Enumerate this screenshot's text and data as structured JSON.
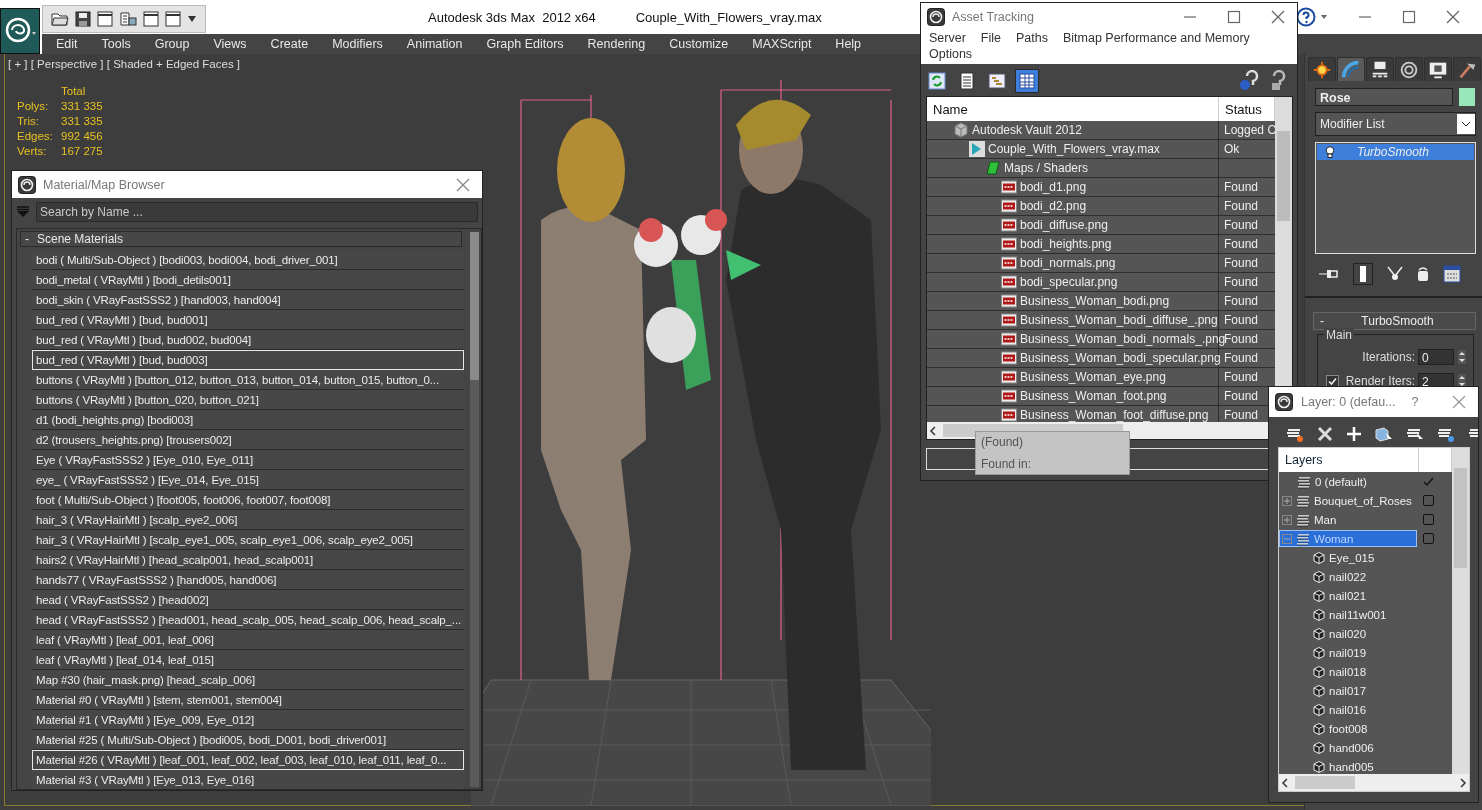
{
  "app": {
    "title": "Autodesk 3ds Max  2012 x64",
    "file": "Couple_With_Flowers_vray.max"
  },
  "menu": [
    "Edit",
    "Tools",
    "Group",
    "Views",
    "Create",
    "Modifiers",
    "Animation",
    "Graph Editors",
    "Rendering",
    "Customize",
    "MAXScript",
    "Help"
  ],
  "viewport": {
    "label": "[ + ] [ Perspective ] [ Shaded + Edged Faces ]",
    "stats_header": "Total",
    "stats": [
      {
        "label": "Polys:",
        "value": "331 335"
      },
      {
        "label": "Tris:",
        "value": "331 335"
      },
      {
        "label": "Edges:",
        "value": "992 456"
      },
      {
        "label": "Verts:",
        "value": "167 275"
      }
    ]
  },
  "material_browser": {
    "title": "Material/Map Browser",
    "placeholder": "Search by Name ...",
    "group": {
      "toggle": "-",
      "label": "Scene Materials"
    },
    "items": [
      {
        "text": "bodi ( Multi/Sub-Object ) [bodi003, bodi004, bodi_driver_001]",
        "selected": false
      },
      {
        "text": "bodi_metal ( VRayMtl ) [bodi_detils001]",
        "selected": false
      },
      {
        "text": "bodi_skin ( VRayFastSSS2 ) [hand003, hand004]",
        "selected": false
      },
      {
        "text": "bud_red ( VRayMtl ) [bud, bud001]",
        "selected": false
      },
      {
        "text": "bud_red ( VRayMtl ) [bud, bud002, bud004]",
        "selected": false
      },
      {
        "text": "bud_red ( VRayMtl ) [bud, bud003]",
        "selected": true
      },
      {
        "text": "buttons ( VRayMtl ) [button_012, button_013, button_014, button_015, button_0...",
        "selected": false
      },
      {
        "text": "buttons ( VRayMtl ) [button_020, button_021]",
        "selected": false
      },
      {
        "text": "d1 (bodi_heights.png) [bodi003]",
        "selected": false
      },
      {
        "text": "d2 (trousers_heights.png) [trousers002]",
        "selected": false
      },
      {
        "text": "Eye ( VRayFastSSS2 ) [Eye_010, Eye_011]",
        "selected": false
      },
      {
        "text": "eye_ ( VRayFastSSS2 ) [Eye_014, Eye_015]",
        "selected": false
      },
      {
        "text": "foot ( Multi/Sub-Object ) [foot005, foot006, foot007, foot008]",
        "selected": false
      },
      {
        "text": "hair_3 ( VRayHairMtl ) [scalp_eye2_006]",
        "selected": false
      },
      {
        "text": "hair_3 ( VRayHairMtl ) [scalp_eye1_005, scalp_eye1_006, scalp_eye2_005]",
        "selected": false
      },
      {
        "text": "hairs2 ( VRayHairMtl ) [head_scalp001, head_scalp001]",
        "selected": false
      },
      {
        "text": "hands77 ( VRayFastSSS2 ) [hand005, hand006]",
        "selected": false
      },
      {
        "text": "head ( VRayFastSSS2 ) [head002]",
        "selected": false
      },
      {
        "text": "head ( VRayFastSSS2 ) [head001, head_scalp_005, head_scalp_006, head_scalp_...",
        "selected": false
      },
      {
        "text": "leaf ( VRayMtl ) [leaf_001, leaf_006]",
        "selected": false
      },
      {
        "text": "leaf ( VRayMtl ) [leaf_014, leaf_015]",
        "selected": false
      },
      {
        "text": "Map #30 (hair_mask.png) [head_scalp_006]",
        "selected": false
      },
      {
        "text": "Material #0 ( VRayMtl ) [stem, stem001, stem004]",
        "selected": false
      },
      {
        "text": "Material #1 ( VRayMtl ) [Eye_009, Eye_012]",
        "selected": false
      },
      {
        "text": "Material #25 ( Multi/Sub-Object ) [bodi005, bodi_D001, bodi_driver001]",
        "selected": false
      },
      {
        "text": "Material #26 ( VRayMtl ) [leaf_001, leaf_002, leaf_003, leaf_010, leaf_011, leaf_0...",
        "selected": true
      },
      {
        "text": "Material #3 ( VRayMtl ) [Eye_013, Eye_016]",
        "selected": false
      }
    ]
  },
  "asset_tracking": {
    "title": "Asset Tracking",
    "menu": [
      "Server",
      "File",
      "Paths",
      "Bitmap Performance and Memory",
      "Options"
    ],
    "view_buttons": [
      {
        "kind": "refresh",
        "selected": false
      },
      {
        "kind": "list",
        "selected": false
      },
      {
        "kind": "tree",
        "selected": false
      },
      {
        "kind": "grid",
        "selected": true
      }
    ],
    "columns": [
      "Name",
      "Status"
    ],
    "rows": [
      {
        "kind": "vault",
        "name": "Autodesk Vault 2012",
        "status": "Logged O",
        "children": [
          {
            "kind": "scene",
            "name": "Couple_With_Flowers_vray.max",
            "status": "Ok",
            "children": [
              {
                "kind": "folder",
                "name": "Maps / Shaders",
                "children": [
                  {
                    "kind": "png",
                    "name": "bodi_d1.png",
                    "status": "Found"
                  },
                  {
                    "kind": "png",
                    "name": "bodi_d2.png",
                    "status": "Found"
                  },
                  {
                    "kind": "png",
                    "name": "bodi_diffuse.png",
                    "status": "Found"
                  },
                  {
                    "kind": "png",
                    "name": "bodi_heights.png",
                    "status": "Found"
                  },
                  {
                    "kind": "png",
                    "name": "bodi_normals.png",
                    "status": "Found"
                  },
                  {
                    "kind": "png",
                    "name": "bodi_specular.png",
                    "status": "Found"
                  },
                  {
                    "kind": "png",
                    "name": "Business_Woman_bodi.png",
                    "status": "Found"
                  },
                  {
                    "kind": "png",
                    "name": "Business_Woman_bodi_diffuse_.png",
                    "status": "Found"
                  },
                  {
                    "kind": "png",
                    "name": "Business_Woman_bodi_normals_.png",
                    "status": "Found"
                  },
                  {
                    "kind": "png",
                    "name": "Business_Woman_bodi_specular.png",
                    "status": "Found"
                  },
                  {
                    "kind": "png",
                    "name": "Business_Woman_eye.png",
                    "status": "Found"
                  },
                  {
                    "kind": "png",
                    "name": "Business_Woman_foot.png",
                    "status": "Found"
                  },
                  {
                    "kind": "png",
                    "name": "Business_Woman_foot_diffuse.png",
                    "status": "Found"
                  }
                ]
              }
            ]
          }
        ]
      }
    ],
    "tooltip": [
      "(Found)",
      "Found in:"
    ]
  },
  "command_panel": {
    "tabs": [
      {
        "kind": "create",
        "selected": false
      },
      {
        "kind": "modify",
        "selected": true
      },
      {
        "kind": "hierarchy",
        "selected": false
      },
      {
        "kind": "motion",
        "selected": false
      },
      {
        "kind": "display",
        "selected": false
      },
      {
        "kind": "utilities",
        "selected": false
      }
    ],
    "object_name": "Rose",
    "color": "#99e6bb",
    "modifier_list": "Modifier List",
    "stack": [
      {
        "name": "TurboSmooth",
        "selected": true
      }
    ],
    "rollout": {
      "toggle": "-",
      "title": "TurboSmooth",
      "group": "Main",
      "iterations": {
        "label": "Iterations:",
        "value": "0"
      },
      "render_iters": {
        "label": "Render Iters:",
        "value": "2",
        "checked": true
      }
    }
  },
  "layer_window": {
    "title": "Layer: 0 (defau...",
    "help": "?",
    "header": "Layers",
    "layers": [
      {
        "name": "0 (default)",
        "current": true,
        "selected": false
      },
      {
        "name": "Bouquet_of_Roses",
        "current": false,
        "expanded": false,
        "selected": false
      },
      {
        "name": "Man",
        "current": false,
        "expanded": false,
        "selected": false
      },
      {
        "name": "Woman",
        "current": false,
        "expanded": true,
        "selected": true,
        "children": [
          {
            "name": "Eye_015"
          },
          {
            "name": "nail022"
          },
          {
            "name": "nail021"
          },
          {
            "name": "nail11w001"
          },
          {
            "name": "nail020"
          },
          {
            "name": "nail019"
          },
          {
            "name": "nail018"
          },
          {
            "name": "nail017"
          },
          {
            "name": "nail016"
          },
          {
            "name": "foot008"
          },
          {
            "name": "hand006"
          },
          {
            "name": "hand005"
          }
        ]
      }
    ]
  }
}
